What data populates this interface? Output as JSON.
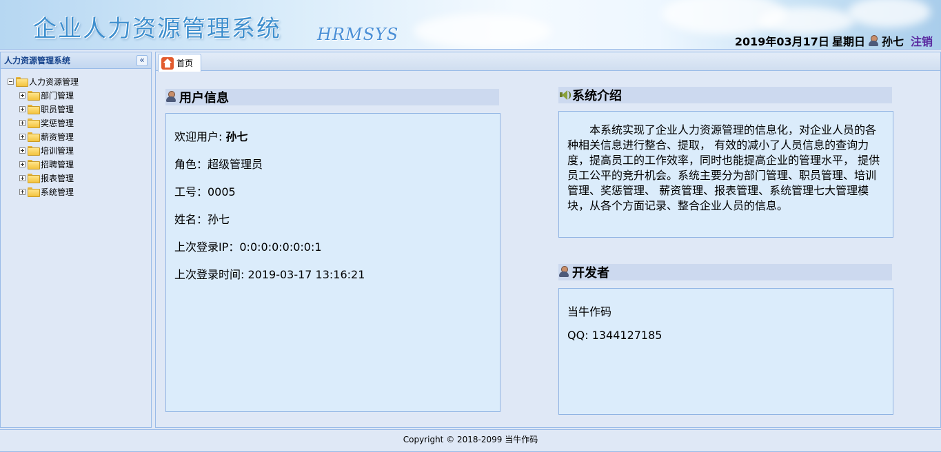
{
  "header": {
    "system_title": "企业人力资源管理系统",
    "system_subtitle": "HRMSYS",
    "date": "2019年03月17日",
    "weekday": "星期日",
    "username": "孙七",
    "logout_label": "注销"
  },
  "sidebar": {
    "title": "人力资源管理系统",
    "root_label": "人力资源管理",
    "items": [
      {
        "label": "部门管理"
      },
      {
        "label": "职员管理"
      },
      {
        "label": "奖惩管理"
      },
      {
        "label": "薪资管理"
      },
      {
        "label": "培训管理"
      },
      {
        "label": "招聘管理"
      },
      {
        "label": "报表管理"
      },
      {
        "label": "系统管理"
      }
    ]
  },
  "tabs": [
    {
      "label": "首页"
    }
  ],
  "user_info": {
    "title": "用户信息",
    "welcome_label": "欢迎用户:",
    "welcome_name": "孙七",
    "role": "角色：超级管理员",
    "employee_id": "工号：0005",
    "name": "姓名：孙七",
    "last_ip": "上次登录IP：0:0:0:0:0:0:0:1",
    "last_login": "上次登录时间: 2019-03-17 13:16:21"
  },
  "system_intro": {
    "title": "系统介绍",
    "text": "本系统实现了企业人力资源管理的信息化，对企业人员的各种相关信息进行整合、提取， 有效的减小了人员信息的查询力度，提高员工的工作效率，同时也能提高企业的管理水平， 提供员工公平的竞升机会。系统主要分为部门管理、职员管理、培训管理、奖惩管理、 薪资管理、报表管理、系统管理七大管理模块，从各个方面记录、整合企业人员的信息。"
  },
  "developer": {
    "title": "开发者",
    "name": "当牛作码",
    "qq": "QQ: 1344127185"
  },
  "footer": {
    "copyright": "Copyright © 2018-2099 当牛作码"
  }
}
